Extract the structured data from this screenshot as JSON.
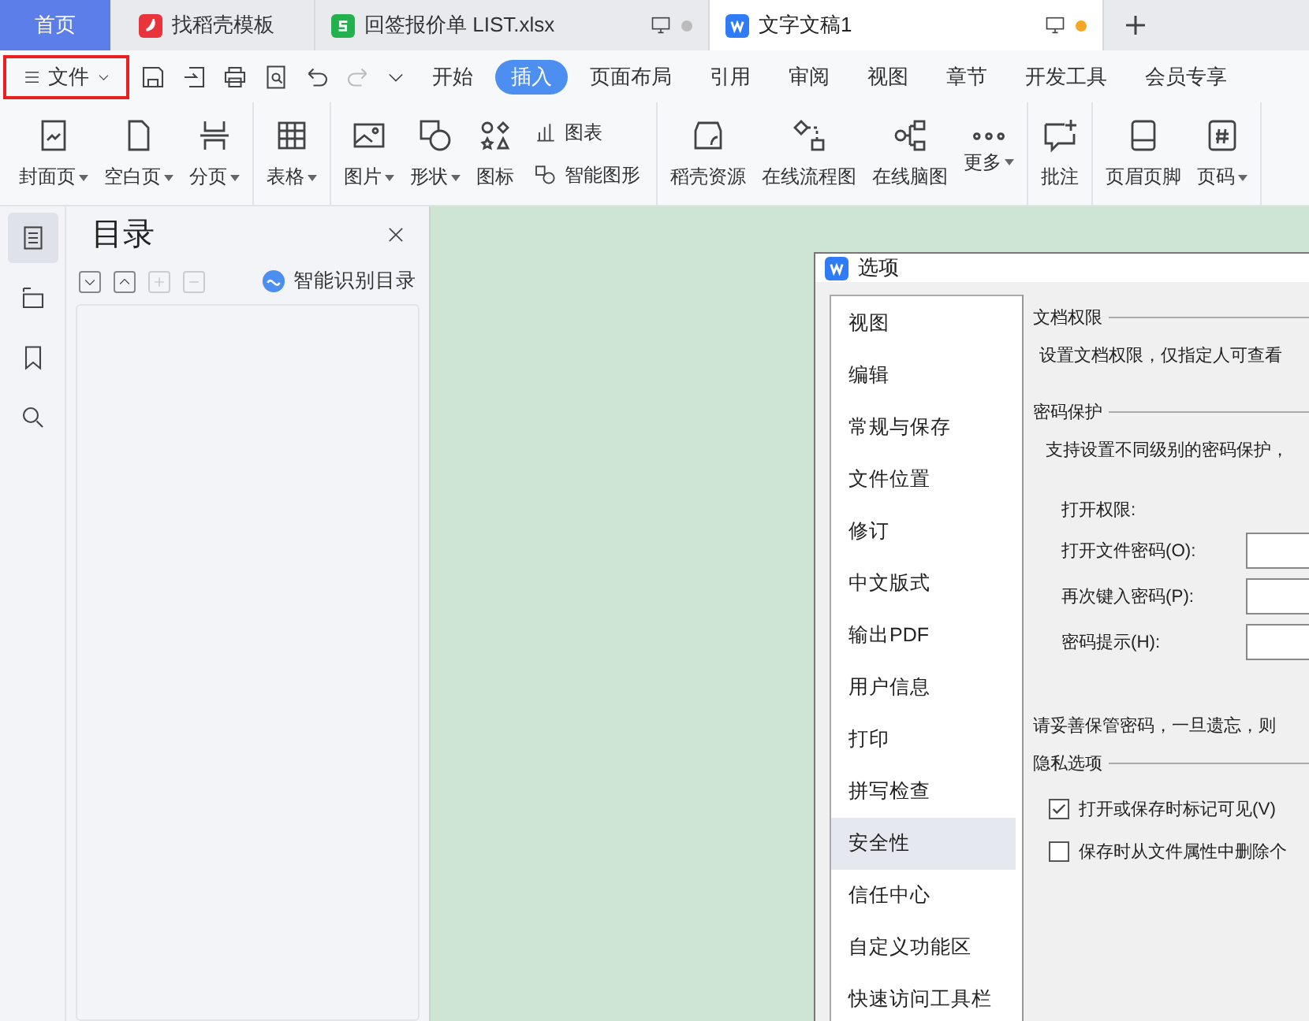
{
  "tabs": [
    {
      "label": "首页",
      "kind": "home",
      "selected": false
    },
    {
      "label": "找稻壳模板",
      "kind": "docer",
      "selected": false
    },
    {
      "label": "回签报价单 LIST.xlsx",
      "kind": "sheet",
      "selected": false
    },
    {
      "label": "文字文稿1",
      "kind": "writer",
      "selected": true
    }
  ],
  "file_menu": {
    "label": "文件",
    "highlighted": true
  },
  "menu_tabs": [
    {
      "label": "开始",
      "selected": false
    },
    {
      "label": "插入",
      "selected": true
    },
    {
      "label": "页面布局",
      "selected": false
    },
    {
      "label": "引用",
      "selected": false
    },
    {
      "label": "审阅",
      "selected": false
    },
    {
      "label": "视图",
      "selected": false
    },
    {
      "label": "章节",
      "selected": false
    },
    {
      "label": "开发工具",
      "selected": false
    },
    {
      "label": "会员专享",
      "selected": false
    }
  ],
  "ribbon_groups": [
    [
      {
        "label": "封面页",
        "caret": true
      },
      {
        "label": "空白页",
        "caret": true
      },
      {
        "label": "分页",
        "caret": true
      }
    ],
    [
      {
        "label": "表格",
        "caret": true
      }
    ],
    [
      {
        "label": "图片",
        "caret": true
      },
      {
        "label": "形状",
        "caret": true
      },
      {
        "label": "图标",
        "caret": false
      },
      {
        "kind": "stack",
        "items": [
          {
            "label": "图表"
          },
          {
            "label": "智能图形"
          }
        ]
      }
    ],
    [
      {
        "label": "稻壳资源",
        "caret": false
      },
      {
        "label": "在线流程图",
        "caret": false
      },
      {
        "label": "在线脑图",
        "caret": false
      },
      {
        "label": "更多",
        "caret": true
      }
    ],
    [
      {
        "label": "批注",
        "caret": false
      }
    ],
    [
      {
        "label": "页眉页脚",
        "caret": false
      },
      {
        "label": "页码",
        "caret": true
      }
    ]
  ],
  "side_icons": [
    {
      "selected": true
    },
    {
      "selected": false
    },
    {
      "selected": false
    },
    {
      "selected": false
    }
  ],
  "toc_panel": {
    "title": "目录",
    "smart_button": "智能识别目录"
  },
  "dialog": {
    "title": "选项",
    "nav": [
      {
        "label": "视图",
        "selected": false
      },
      {
        "label": "编辑",
        "selected": false
      },
      {
        "label": "常规与保存",
        "selected": false
      },
      {
        "label": "文件位置",
        "selected": false
      },
      {
        "label": "修订",
        "selected": false
      },
      {
        "label": "中文版式",
        "selected": false
      },
      {
        "label": "输出PDF",
        "selected": false
      },
      {
        "label": "用户信息",
        "selected": false
      },
      {
        "label": "打印",
        "selected": false
      },
      {
        "label": "拼写检查",
        "selected": false
      },
      {
        "label": "安全性",
        "selected": true
      },
      {
        "label": "信任中心",
        "selected": false
      },
      {
        "label": "自定义功能区",
        "selected": false
      },
      {
        "label": "快速访问工具栏",
        "selected": false
      }
    ],
    "doc_rights": {
      "heading": "文档权限",
      "text": "设置文档权限，仅指定人可查看"
    },
    "password": {
      "heading": "密码保护",
      "text": "支持设置不同级别的密码保护，",
      "open_rights": "打开权限:",
      "fields": [
        {
          "label": "打开文件密码(O):"
        },
        {
          "label": "再次键入密码(P):"
        },
        {
          "label": "密码提示(H):"
        }
      ],
      "warning": "请妥善保管密码，一旦遗忘，则"
    },
    "privacy": {
      "heading": "隐私选项",
      "options": [
        {
          "label": "打开或保存时标记可见(V)",
          "checked": true
        },
        {
          "label": "保存时从文件属性中删除个",
          "checked": false
        }
      ]
    }
  }
}
